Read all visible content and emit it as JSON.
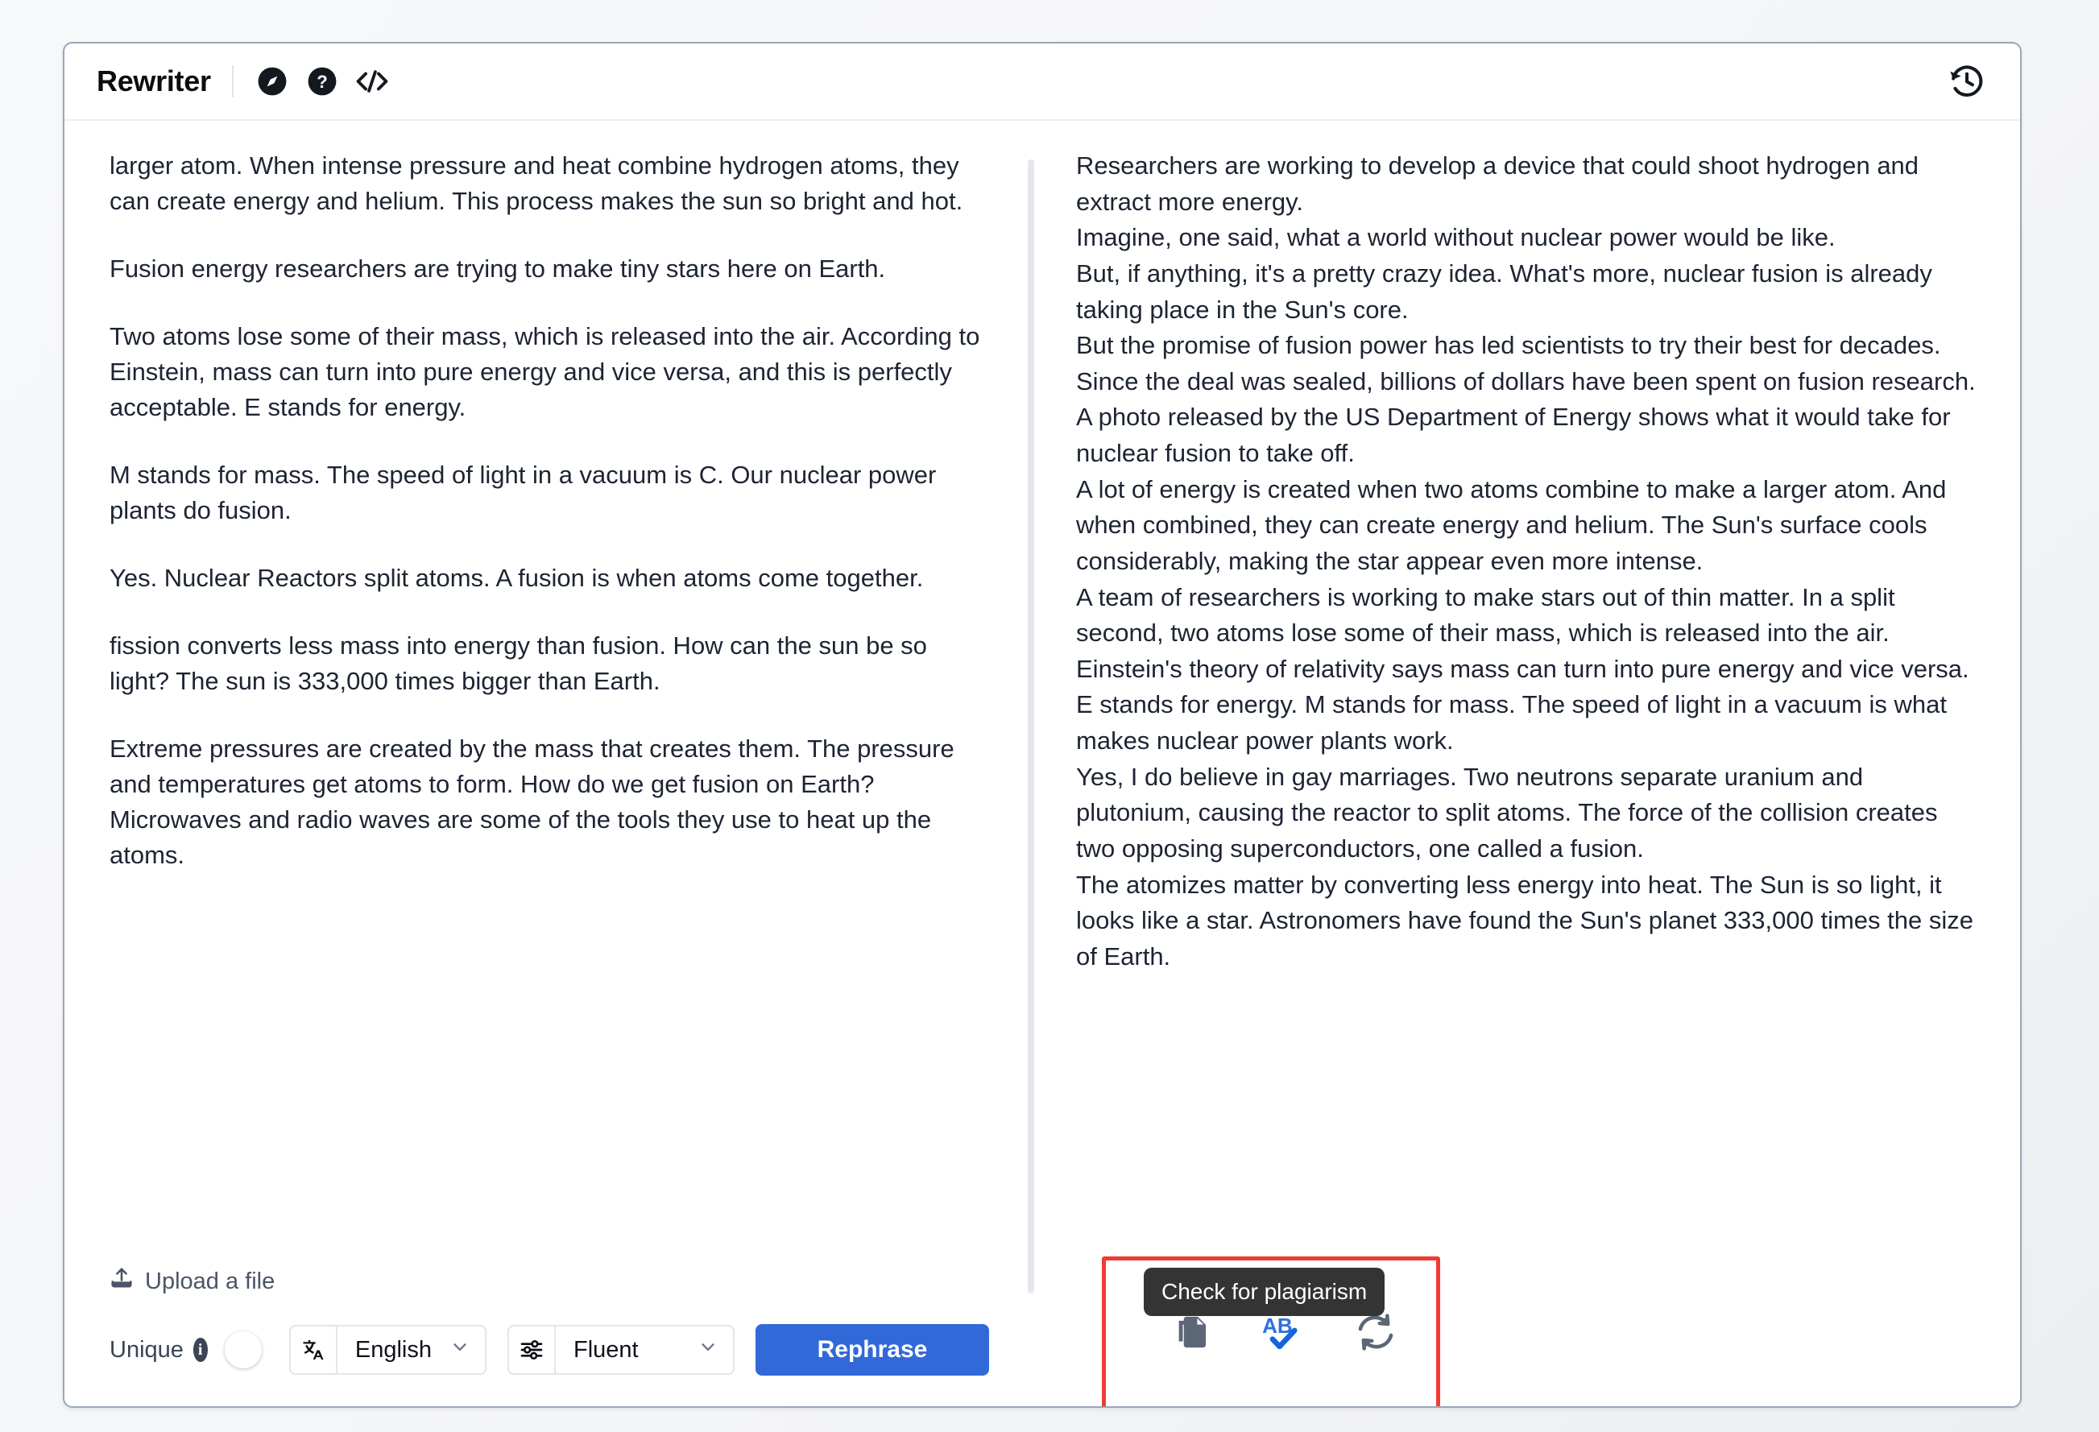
{
  "header": {
    "title": "Rewriter",
    "icons": [
      {
        "name": "compass-icon",
        "glyph": "compass"
      },
      {
        "name": "help-circle-icon",
        "glyph": "question"
      },
      {
        "name": "code-brackets-icon",
        "glyph": "code"
      }
    ],
    "history_icon_label": "History"
  },
  "source": {
    "paragraphs": [
      "larger atom. When intense pressure and heat combine hydrogen atoms, they can create energy and helium. This process makes the sun so bright and hot.",
      "Fusion energy researchers are trying to make tiny stars here on Earth.",
      "Two atoms lose some of their mass, which is released into the air. According to Einstein, mass can turn into pure energy and vice versa, and this is perfectly acceptable. E stands for energy.",
      "M stands for mass. The speed of light in a vacuum is C. Our nuclear power plants do fusion.",
      "Yes. Nuclear Reactors split atoms. A fusion is when atoms come together.",
      "fission converts less mass into energy than fusion. How can the sun be so light? The sun is 333,000 times bigger than Earth.",
      "Extreme pressures are created by the mass that creates them. The pressure and temperatures get atoms to form. How do we get fusion on Earth? Microwaves and radio waves are some of the tools they use to heat up the atoms."
    ]
  },
  "upload": {
    "label": "Upload a file",
    "icon": "upload-icon"
  },
  "toolbar": {
    "unique_label": "Unique",
    "info_badge": "i",
    "toggle_state": "off",
    "language_icon": "translate-icon",
    "language_value": "English",
    "mode_icon": "sliders-icon",
    "mode_value": "Fluent",
    "rephrase_label": "Rephrase",
    "chevron": "chevron-down-icon",
    "accent_color": "#3269d9"
  },
  "result": {
    "sentences": [
      {
        "text": "Researchers are working to develop a device that could shoot hydrogen and extract more energy.",
        "underlined": true,
        "break_after": true
      },
      {
        "text": "Imagine, one said, what a world without nuclear power would be like.",
        "underlined": true,
        "break_after": true
      },
      {
        "text": "But, if anything, it's a pretty crazy idea.",
        "underlined": true,
        "break_after": false
      },
      {
        "text": "What's more, nuclear fusion is already taking place in the Sun's core.",
        "underlined": true,
        "break_after": true
      },
      {
        "text": "But the promise of fusion power has led scientists to try their best for decades.",
        "underlined": true,
        "break_after": false
      },
      {
        "text": "Since the deal was sealed, billions of dollars have been spent on fusion research.",
        "underlined": true,
        "break_after": false
      },
      {
        "text": "A photo released by the US Department of Energy shows what it would take for nuclear fusion to take off.",
        "underlined": true,
        "break_after": true
      },
      {
        "text": "A lot of energy is created when two atoms combine to make a larger atom.",
        "underlined": true,
        "break_after": false
      },
      {
        "text": "And when combined, they can create energy and helium.",
        "underlined": true,
        "break_after": false
      },
      {
        "text": "The Sun's surface cools considerably, making the star appear even more intense.",
        "underlined": true,
        "break_after": true
      },
      {
        "text": "A team of researchers is working to make stars out of thin matter.",
        "underlined": true,
        "break_after": false
      },
      {
        "text": "In a split second, two atoms lose some of their mass, which is released into the air.",
        "underlined": true,
        "break_after": false
      },
      {
        "text": "Einstein's theory of relativity says mass can turn into pure energy and vice versa.",
        "underlined": true,
        "break_after": true
      },
      {
        "text": "E stands for energy. M stands for mass.",
        "underlined": false,
        "break_after": false
      },
      {
        "text": "The speed of light in a vacuum is what makes nuclear power plants work.",
        "underlined": true,
        "break_after": true
      },
      {
        "text": "Yes, I do believe in gay marriages.",
        "underlined": true,
        "break_after": false
      },
      {
        "text": "Two neutrons separate uranium and plutonium, causing the reactor to split atoms.",
        "underlined": true,
        "break_after": false
      },
      {
        "text": "The force of the collision creates two opposing superconductors, one called a fusion.",
        "underlined": true,
        "break_after": true
      },
      {
        "text": "The atomizes matter by converting less energy into heat.",
        "underlined": true,
        "break_after": false
      },
      {
        "text": "The Sun is so light, it looks like a star.",
        "underlined": true,
        "break_after": false
      },
      {
        "text": "Astronomers have found the Sun's planet 333,000 times the size of Earth.",
        "underlined": true,
        "break_after": false
      }
    ]
  },
  "action_bar": {
    "tooltip": "Check for plagiarism",
    "buttons": [
      {
        "name": "copy-icon",
        "label": "Copy"
      },
      {
        "name": "plagiarism-check-icon",
        "label": "Check for plagiarism"
      },
      {
        "name": "regenerate-icon",
        "label": "Regenerate"
      }
    ],
    "annotation_color": "#f23b33"
  }
}
